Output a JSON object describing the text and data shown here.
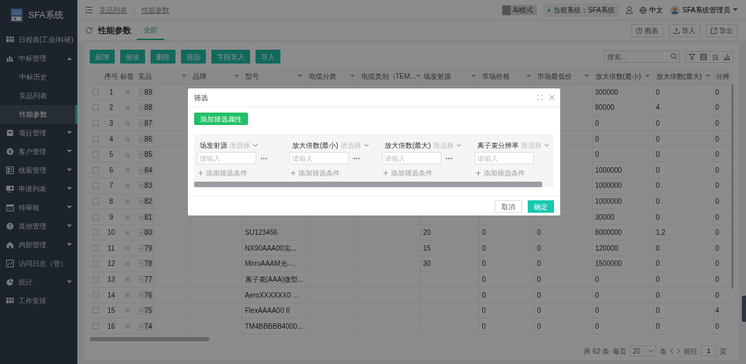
{
  "sidebar": {
    "logo_text": "SFA系统",
    "items": [
      {
        "label": "日程表(工业/科研)",
        "kind": "link",
        "selected": false
      },
      {
        "label": "中标管理",
        "kind": "group",
        "expanded": true,
        "selected": false,
        "children": [
          {
            "label": "中标历史",
            "selected": false
          },
          {
            "label": "竞品列表",
            "selected": false
          },
          {
            "label": "性能参数",
            "selected": true
          }
        ]
      },
      {
        "label": "项目管理",
        "kind": "group",
        "expanded": false,
        "selected": false
      },
      {
        "label": "客户管理",
        "kind": "group",
        "expanded": false,
        "selected": false
      },
      {
        "label": "线索管理",
        "kind": "group",
        "expanded": false,
        "selected": false
      },
      {
        "label": "申请列表",
        "kind": "group",
        "expanded": false,
        "selected": false
      },
      {
        "label": "待审核",
        "kind": "group",
        "expanded": false,
        "selected": false
      },
      {
        "label": "其他管理",
        "kind": "group",
        "expanded": false,
        "selected": false
      },
      {
        "label": "内部管理",
        "kind": "group",
        "expanded": false,
        "selected": false
      },
      {
        "label": "访问日志（管）",
        "kind": "link",
        "selected": false
      },
      {
        "label": "统计",
        "kind": "group",
        "expanded": false,
        "selected": false
      },
      {
        "label": "工作安排",
        "kind": "link",
        "selected": false
      }
    ]
  },
  "topbar": {
    "breadcrumbs": [
      "竞品列表",
      "性能参数"
    ],
    "ai_mode": {
      "label": "AI模式",
      "on": false
    },
    "system": "当前系统：SFA系统",
    "language": "中文",
    "user": "SFA系统管理员"
  },
  "page": {
    "title": "性能参数",
    "tabs": [
      {
        "label": "全部",
        "selected": true
      }
    ],
    "buttons": [
      "图表",
      "导入",
      "导出"
    ]
  },
  "toolbar": {
    "actions": [
      "新增",
      "修改",
      "删除",
      "筛选",
      "字段导入",
      "导入"
    ],
    "search": {
      "placeholder": "搜索..."
    }
  },
  "table": {
    "columns": [
      "序号",
      "标签",
      "竞品",
      "品牌",
      "型号",
      "电缆分类",
      "电缆类别（TEM...",
      "场发射源",
      "市场价格",
      "市场最低价",
      "放大倍数(最小)",
      "放大倍数(最大)",
      "分辨"
    ],
    "rows": [
      {
        "checked": false,
        "cells": [
          "1",
          null,
          "· 89",
          null,
          null,
          null,
          null,
          null,
          null,
          null,
          "300000",
          "0",
          "0"
        ]
      },
      {
        "checked": false,
        "cells": [
          "2",
          null,
          "· 88",
          null,
          null,
          null,
          null,
          null,
          null,
          null,
          "80000",
          "4",
          "0"
        ]
      },
      {
        "checked": false,
        "cells": [
          "3",
          null,
          "· 87",
          null,
          null,
          null,
          null,
          null,
          null,
          null,
          "0",
          "0",
          "0"
        ]
      },
      {
        "checked": false,
        "cells": [
          "4",
          null,
          "· 86",
          null,
          null,
          null,
          null,
          null,
          null,
          null,
          "0",
          "0",
          "0"
        ]
      },
      {
        "checked": false,
        "cells": [
          "5",
          null,
          "· 85",
          null,
          null,
          null,
          null,
          null,
          null,
          null,
          "0",
          "0",
          "0"
        ]
      },
      {
        "checked": false,
        "cells": [
          "6",
          null,
          "· 84",
          null,
          null,
          null,
          null,
          null,
          null,
          null,
          "1000000",
          "0",
          "0"
        ]
      },
      {
        "checked": false,
        "cells": [
          "7",
          null,
          "· 83",
          null,
          null,
          null,
          null,
          null,
          null,
          null,
          "1000000",
          "0",
          "0"
        ]
      },
      {
        "checked": false,
        "cells": [
          "8",
          null,
          "· 82",
          null,
          null,
          null,
          null,
          null,
          null,
          null,
          "1000000",
          "0",
          "0"
        ]
      },
      {
        "checked": false,
        "cells": [
          "9",
          null,
          "· 81",
          null,
          null,
          null,
          null,
          null,
          null,
          null,
          "30000",
          "0",
          "0"
        ]
      },
      {
        "checked": false,
        "cells": [
          "10",
          null,
          "· 80",
          null,
          "SU123456",
          null,
          null,
          "20",
          "0",
          "0",
          "8000000",
          "1.2",
          "0"
        ]
      },
      {
        "checked": false,
        "cells": [
          "11",
          null,
          "· 79",
          null,
          "NX90AAA00实...",
          null,
          null,
          "15",
          "0",
          "0",
          "120000",
          "0",
          "0"
        ]
      },
      {
        "checked": false,
        "cells": [
          "12",
          null,
          "· 78",
          null,
          "MirroAAAM光-...",
          null,
          null,
          "30",
          "0",
          "0",
          "1500000",
          "0",
          "0"
        ]
      },
      {
        "checked": false,
        "cells": [
          "13",
          null,
          "· 77",
          null,
          "离子束(AAA)微型...",
          null,
          null,
          null,
          "0",
          "0",
          "0",
          "0",
          "0"
        ]
      },
      {
        "checked": false,
        "cells": [
          "14",
          null,
          "· 76",
          null,
          "AeroXXXXXX0 ...",
          null,
          null,
          null,
          "0",
          "0",
          "0",
          "0",
          "0"
        ]
      },
      {
        "checked": false,
        "cells": [
          "15",
          null,
          "· 75",
          null,
          "FlexAAAA00 II",
          null,
          null,
          null,
          "0",
          "0",
          "0",
          "0",
          "4"
        ]
      },
      {
        "checked": false,
        "cells": [
          "16",
          null,
          "· 74",
          null,
          "TM4BBBBB4000...",
          null,
          null,
          null,
          "0",
          "0",
          "0",
          "0",
          "0"
        ]
      }
    ]
  },
  "pagination": {
    "total": "共 62 条",
    "per_page_label": "每页",
    "per_page": "20",
    "unit": "条",
    "goto_label": "前往",
    "page": "1",
    "page_unit": "页"
  },
  "modal": {
    "title": "筛选",
    "add_button": "添加筛选属性",
    "filters": [
      {
        "field": "场发射源",
        "operator_placeholder": "请选择",
        "value_placeholder": "请输入",
        "add_condition": "添加筛选条件"
      },
      {
        "field": "放大倍数(最小)",
        "operator_placeholder": "请选择",
        "value_placeholder": "请输入",
        "add_condition": "添加筛选条件"
      },
      {
        "field": "放大倍数(最大)",
        "operator_placeholder": "请选择",
        "value_placeholder": "请输入",
        "add_condition": "添加筛选条件"
      },
      {
        "field": "离子束分辨率",
        "operator_placeholder": "请选择",
        "value_placeholder": "请输入",
        "add_condition": "添加筛选条件"
      }
    ],
    "cancel": "取消",
    "confirm": "确定"
  }
}
